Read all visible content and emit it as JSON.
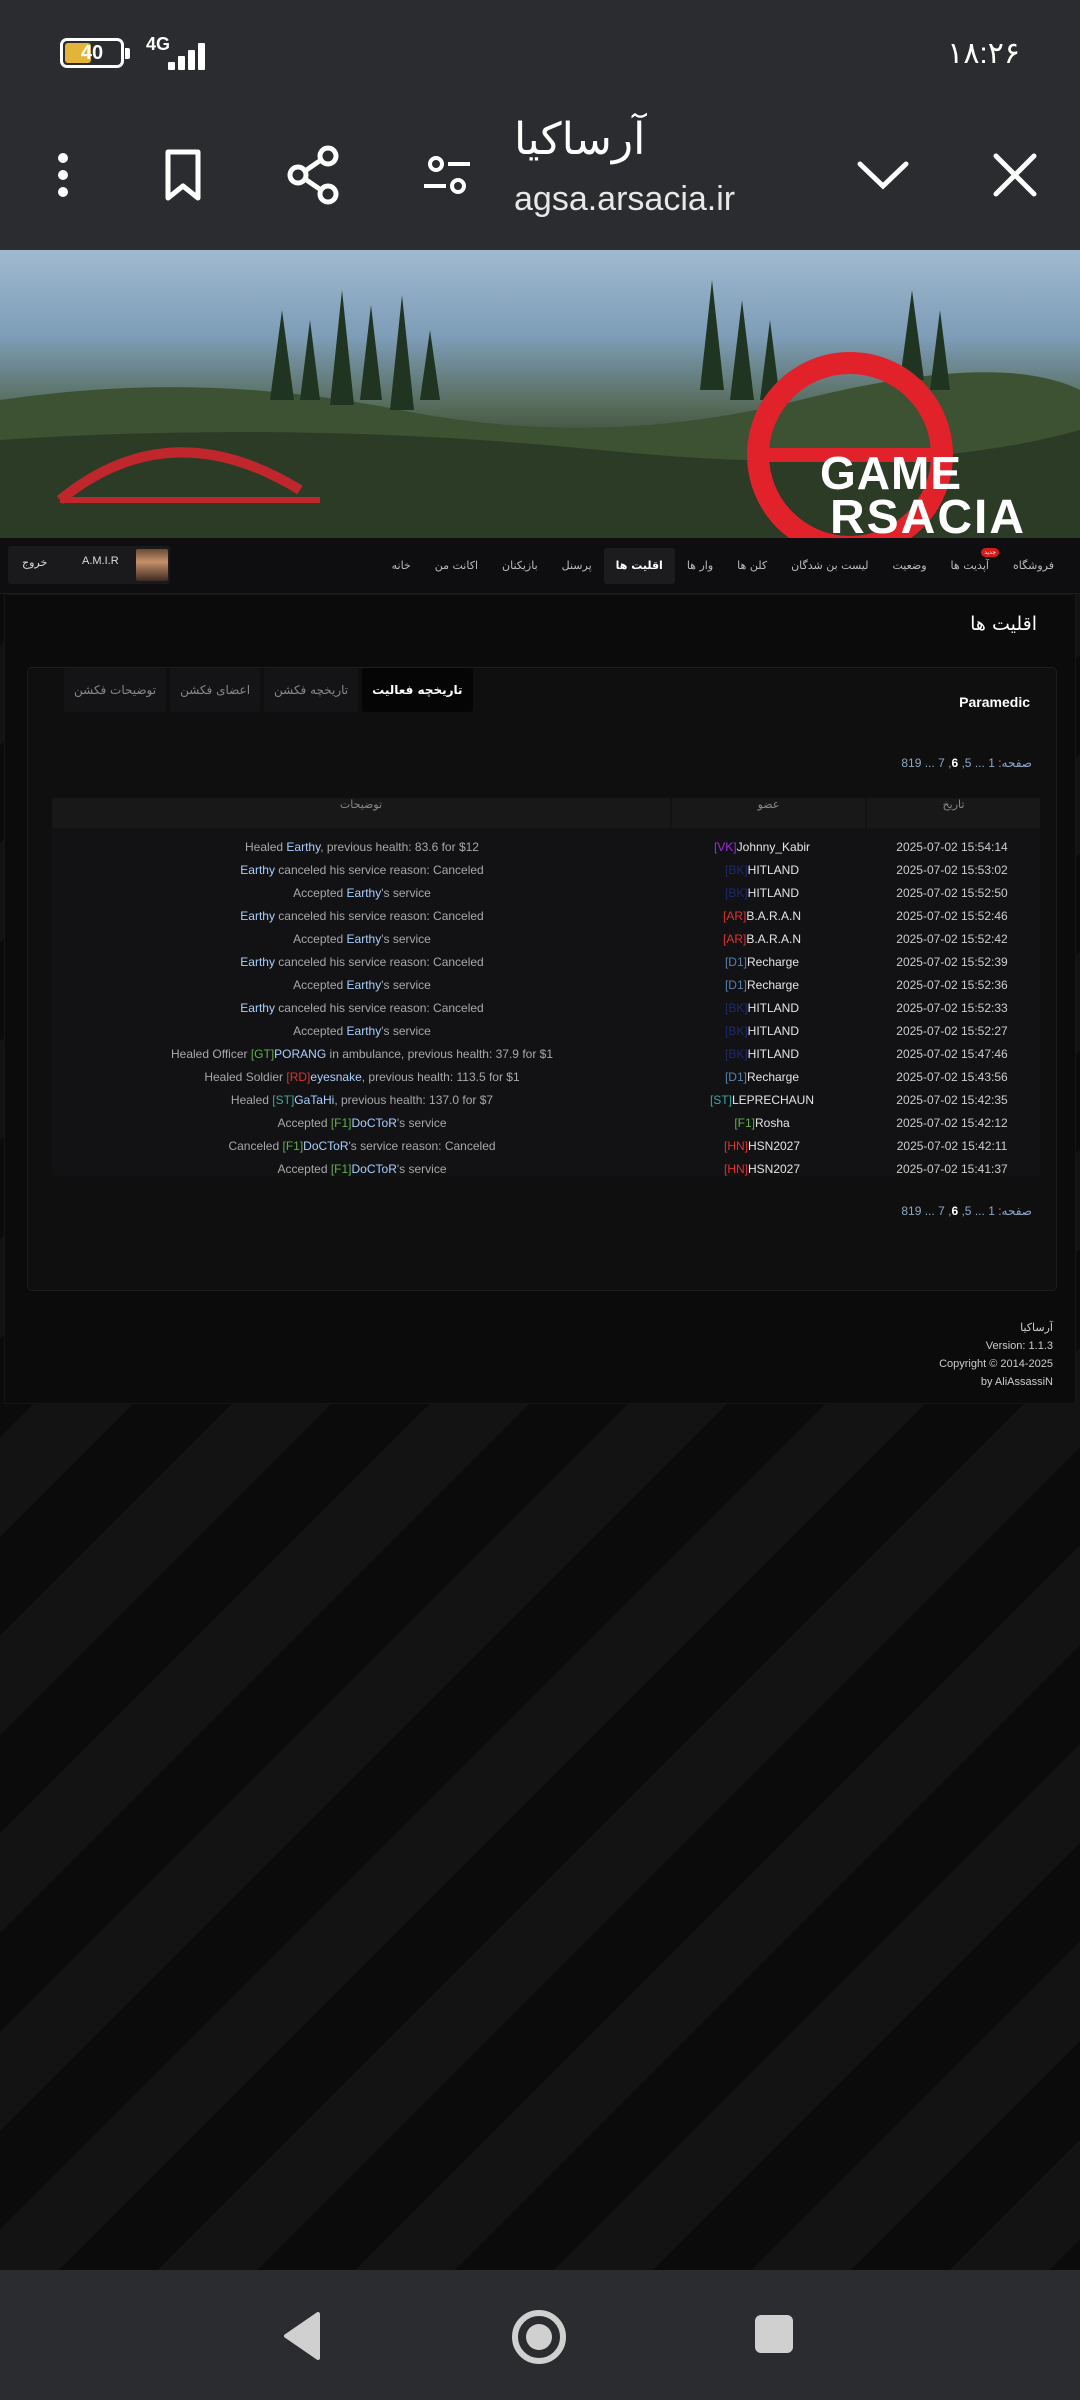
{
  "status": {
    "battery": "40",
    "network": "4G",
    "time": "۱۸:۲۶"
  },
  "browser": {
    "title": "آرساکیا",
    "url": "agsa.arsacia.ir"
  },
  "banner": {
    "logo_line1": "GAME",
    "logo_line2": "RSACIA"
  },
  "nav": {
    "items": [
      {
        "label": "خانه",
        "active": false
      },
      {
        "label": "اکانت من",
        "active": false
      },
      {
        "label": "بازیکنان",
        "active": false
      },
      {
        "label": "پرسنل",
        "active": false
      },
      {
        "label": "اقلیت ها",
        "active": true
      },
      {
        "label": "وار ها",
        "active": false
      },
      {
        "label": "کلن ها",
        "active": false
      },
      {
        "label": "لیست بن شدگان",
        "active": false
      },
      {
        "label": "وضعیت",
        "active": false
      },
      {
        "label": "آپدیت ها",
        "active": false,
        "badge": "جدید"
      },
      {
        "label": "فروشگاه",
        "active": false
      }
    ],
    "username": "A.M.I.R",
    "logout": "خروج"
  },
  "page": {
    "title": "اقلیت ها",
    "faction": "Paramedic",
    "tabs": [
      "توضیحات فکشن",
      "اعضای فکشن",
      "تاریخچه فکشن",
      "تاریخچه فعالیت"
    ],
    "active_tab": "تاریخچه فعالیت",
    "pager": {
      "prefix": "صفحه:",
      "first": "1",
      "dots": "...",
      "p5": "5",
      "current": "6",
      "p7": "7",
      "last": "819"
    },
    "table": {
      "headers": {
        "date": "تاریخ",
        "member": "عضو",
        "desc": "توضیحات"
      },
      "rows": [
        {
          "date": "2025-07-02 15:54:14",
          "tag": "[VK]",
          "tagc": "purple",
          "name": "Johnny_Kabir",
          "d": [
            "Healed ",
            "Earthy",
            ", previous health: 83.6 for $12"
          ]
        },
        {
          "date": "2025-07-02 15:53:02",
          "tag": "[BK]",
          "tagc": "navy",
          "name": "HITLAND",
          "d": [
            "",
            "Earthy",
            " canceled his service reason: Canceled"
          ]
        },
        {
          "date": "2025-07-02 15:52:50",
          "tag": "[BK]",
          "tagc": "navy",
          "name": "HITLAND",
          "d": [
            "Accepted ",
            "Earthy",
            "'s service"
          ]
        },
        {
          "date": "2025-07-02 15:52:46",
          "tag": "[AR]",
          "tagc": "red",
          "name": "B.A.R.A.N",
          "d": [
            "",
            "Earthy",
            " canceled his service reason: Canceled"
          ]
        },
        {
          "date": "2025-07-02 15:52:42",
          "tag": "[AR]",
          "tagc": "red",
          "name": "B.A.R.A.N",
          "d": [
            "Accepted ",
            "Earthy",
            "'s service"
          ]
        },
        {
          "date": "2025-07-02 15:52:39",
          "tag": "[D1]",
          "tagc": "blue",
          "name": "Recharge",
          "d": [
            "",
            "Earthy",
            " canceled his service reason: Canceled"
          ]
        },
        {
          "date": "2025-07-02 15:52:36",
          "tag": "[D1]",
          "tagc": "blue",
          "name": "Recharge",
          "d": [
            "Accepted ",
            "Earthy",
            "'s service"
          ]
        },
        {
          "date": "2025-07-02 15:52:33",
          "tag": "[BK]",
          "tagc": "navy",
          "name": "HITLAND",
          "d": [
            "",
            "Earthy",
            " canceled his service reason: Canceled"
          ]
        },
        {
          "date": "2025-07-02 15:52:27",
          "tag": "[BK]",
          "tagc": "navy",
          "name": "HITLAND",
          "d": [
            "Accepted ",
            "Earthy",
            "'s service"
          ]
        },
        {
          "date": "2025-07-02 15:47:46",
          "tag": "[BK]",
          "tagc": "navy",
          "name": "HITLAND",
          "d": [
            "Healed Officer ",
            "[GT]",
            "PORANG",
            " in ambulance, previous health: 37.9 for $1"
          ],
          "dtag": "green"
        },
        {
          "date": "2025-07-02 15:43:56",
          "tag": "[D1]",
          "tagc": "blue",
          "name": "Recharge",
          "d": [
            "Healed Soldier ",
            "[RD]",
            "eyesnake",
            ", previous health: 113.5 for $1"
          ],
          "dtag": "red"
        },
        {
          "date": "2025-07-02 15:42:35",
          "tag": "[ST]",
          "tagc": "teal",
          "name": "LEPRECHAUN",
          "d": [
            "Healed ",
            "[ST]",
            "GaTaHi",
            ", previous health: 137.0 for $7"
          ],
          "dtag": "teal"
        },
        {
          "date": "2025-07-02 15:42:12",
          "tag": "[F1]",
          "tagc": "green",
          "name": "Rosha",
          "d": [
            "Accepted ",
            "[F1]",
            "DoCToR",
            "'s service"
          ],
          "dtag": "green"
        },
        {
          "date": "2025-07-02 15:42:11",
          "tag": "[HN]",
          "tagc": "red",
          "name": "HSN2027",
          "d": [
            "Canceled ",
            "[F1]",
            "DoCToR",
            "'s service reason: Canceled"
          ],
          "dtag": "green"
        },
        {
          "date": "2025-07-02 15:41:37",
          "tag": "[HN]",
          "tagc": "red",
          "name": "HSN2027",
          "d": [
            "Accepted ",
            "[F1]",
            "DoCToR",
            "'s service"
          ],
          "dtag": "green"
        }
      ]
    },
    "footer": {
      "line1": "آرساکیا",
      "line2": "Version: 1.1.3",
      "line3": "Copyright © 2014-2025",
      "line4": "by AliAssassiN"
    }
  }
}
